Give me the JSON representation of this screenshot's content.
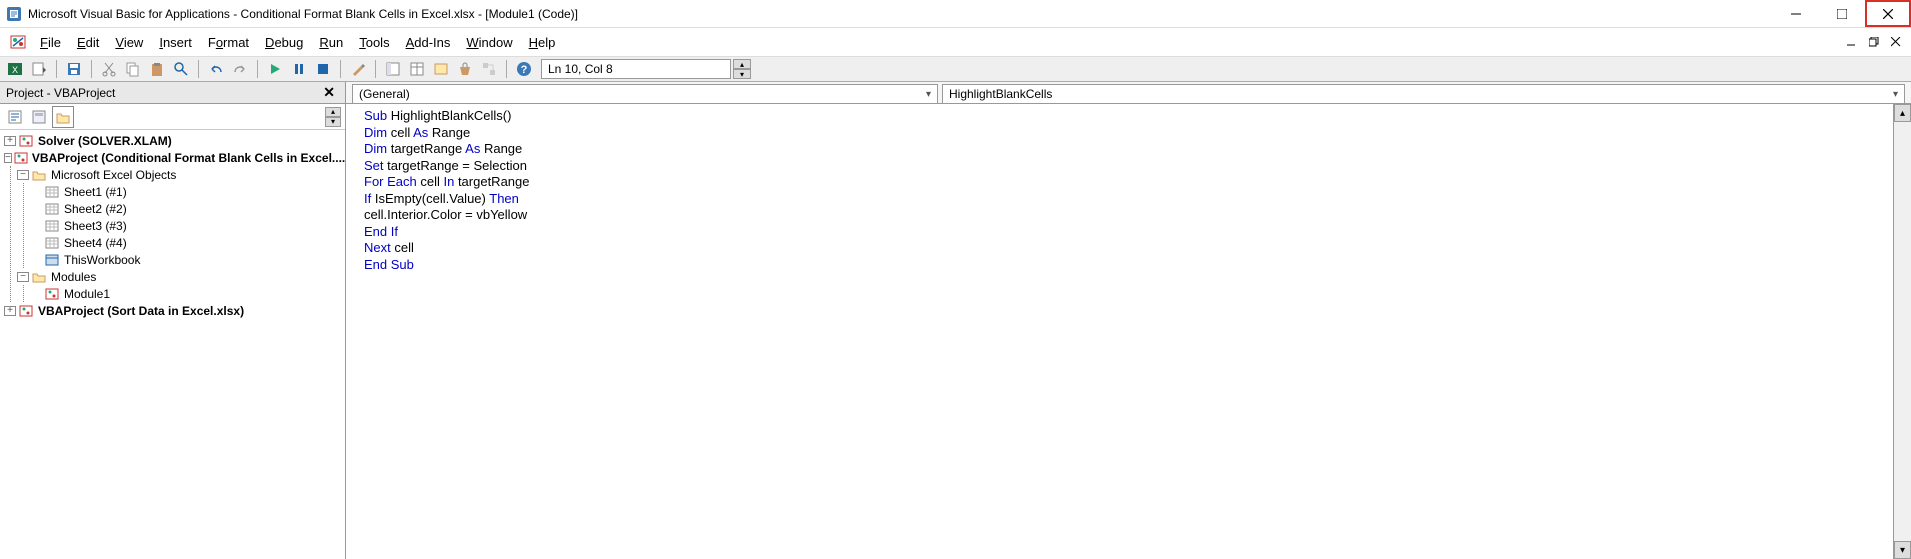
{
  "window": {
    "title": "Microsoft Visual Basic for Applications - Conditional Format Blank Cells in Excel.xlsx - [Module1 (Code)]"
  },
  "menu": {
    "file": "File",
    "edit": "Edit",
    "view": "View",
    "insert": "Insert",
    "format": "Format",
    "debug": "Debug",
    "run": "Run",
    "tools": "Tools",
    "addins": "Add-Ins",
    "window": "Window",
    "help": "Help"
  },
  "toolbar": {
    "cursor_position": "Ln 10, Col 8"
  },
  "project": {
    "title": "Project - VBAProject",
    "nodes": {
      "solver": "Solver (SOLVER.XLAM)",
      "vba1": "VBAProject (Conditional Format Blank Cells in Excel....)",
      "excel_objects": "Microsoft Excel Objects",
      "sheet1": "Sheet1 (#1)",
      "sheet2": "Sheet2 (#2)",
      "sheet3": "Sheet3 (#3)",
      "sheet4": "Sheet4 (#4)",
      "thisworkbook": "ThisWorkbook",
      "modules": "Modules",
      "module1": "Module1",
      "vba2": "VBAProject (Sort Data in Excel.xlsx)"
    }
  },
  "code": {
    "object_dd": "(General)",
    "proc_dd": "HighlightBlankCells",
    "lines": [
      {
        "t": [
          {
            "k": "Sub",
            "kw": true
          },
          {
            "k": " HighlightBlankCells()",
            "kw": false
          }
        ]
      },
      {
        "t": [
          {
            "k": "Dim",
            "kw": true
          },
          {
            "k": " cell ",
            "kw": false
          },
          {
            "k": "As",
            "kw": true
          },
          {
            "k": " Range",
            "kw": false
          }
        ]
      },
      {
        "t": [
          {
            "k": "Dim",
            "kw": true
          },
          {
            "k": " targetRange ",
            "kw": false
          },
          {
            "k": "As",
            "kw": true
          },
          {
            "k": " Range",
            "kw": false
          }
        ]
      },
      {
        "t": [
          {
            "k": "Set",
            "kw": true
          },
          {
            "k": " targetRange = Selection",
            "kw": false
          }
        ]
      },
      {
        "t": [
          {
            "k": "For Each",
            "kw": true
          },
          {
            "k": " cell ",
            "kw": false
          },
          {
            "k": "In",
            "kw": true
          },
          {
            "k": " targetRange",
            "kw": false
          }
        ]
      },
      {
        "t": [
          {
            "k": "If",
            "kw": true
          },
          {
            "k": " IsEmpty(cell.Value) ",
            "kw": false
          },
          {
            "k": "Then",
            "kw": true
          }
        ]
      },
      {
        "t": [
          {
            "k": "cell.Interior.Color = vbYellow",
            "kw": false
          }
        ]
      },
      {
        "t": [
          {
            "k": "End If",
            "kw": true
          }
        ]
      },
      {
        "t": [
          {
            "k": "Next",
            "kw": true
          },
          {
            "k": " cell",
            "kw": false
          }
        ]
      },
      {
        "t": [
          {
            "k": "End Sub",
            "kw": true
          }
        ]
      }
    ]
  }
}
